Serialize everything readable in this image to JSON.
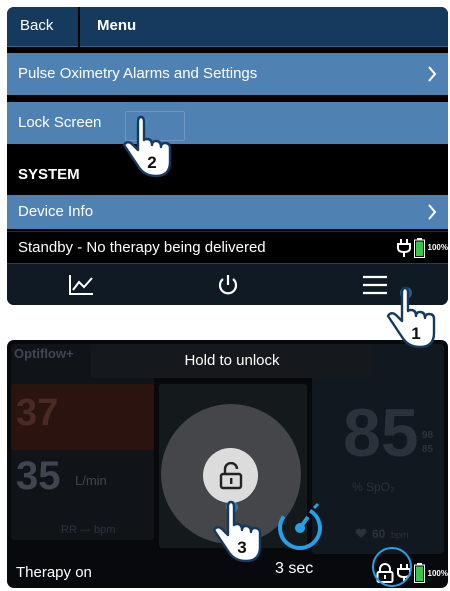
{
  "screen1": {
    "header": {
      "back_label": "Back",
      "title": "Menu"
    },
    "menu_items": [
      {
        "label": "Pulse Oximetry Alarms and Settings"
      },
      {
        "label": "Lock Screen"
      }
    ],
    "section_label": "SYSTEM",
    "system_items": [
      {
        "label": "Device Info"
      }
    ],
    "status_text": "Standby - No therapy being delivered",
    "battery_percent": "100%",
    "nav_icons": [
      "trend-chart-icon",
      "power-icon",
      "hamburger-menu-icon"
    ]
  },
  "screen2": {
    "hold_prompt": "Hold to unlock",
    "timer_label": "3 sec",
    "status_text": "Therapy on",
    "battery_percent": "100%",
    "background_values": {
      "flow_tab": "Optiflow+",
      "oxygen_value": "37",
      "flow_value": "35",
      "flow_unit": "L/min",
      "rr_label": "RR — bpm",
      "spo2_value": "85",
      "spo2_side_top": "98",
      "spo2_side_bottom": "85",
      "spo2_label": "% SpO₂",
      "pulse_value": "60",
      "pulse_unit": "bpm"
    }
  },
  "annotations": {
    "step_1": "1",
    "step_2": "2",
    "step_3": "3"
  },
  "colors": {
    "header_blue": "#163a5e",
    "row_blue": "#4f82b3",
    "accent_cyan": "#27a0e6",
    "battery_green": "#38c54a"
  }
}
